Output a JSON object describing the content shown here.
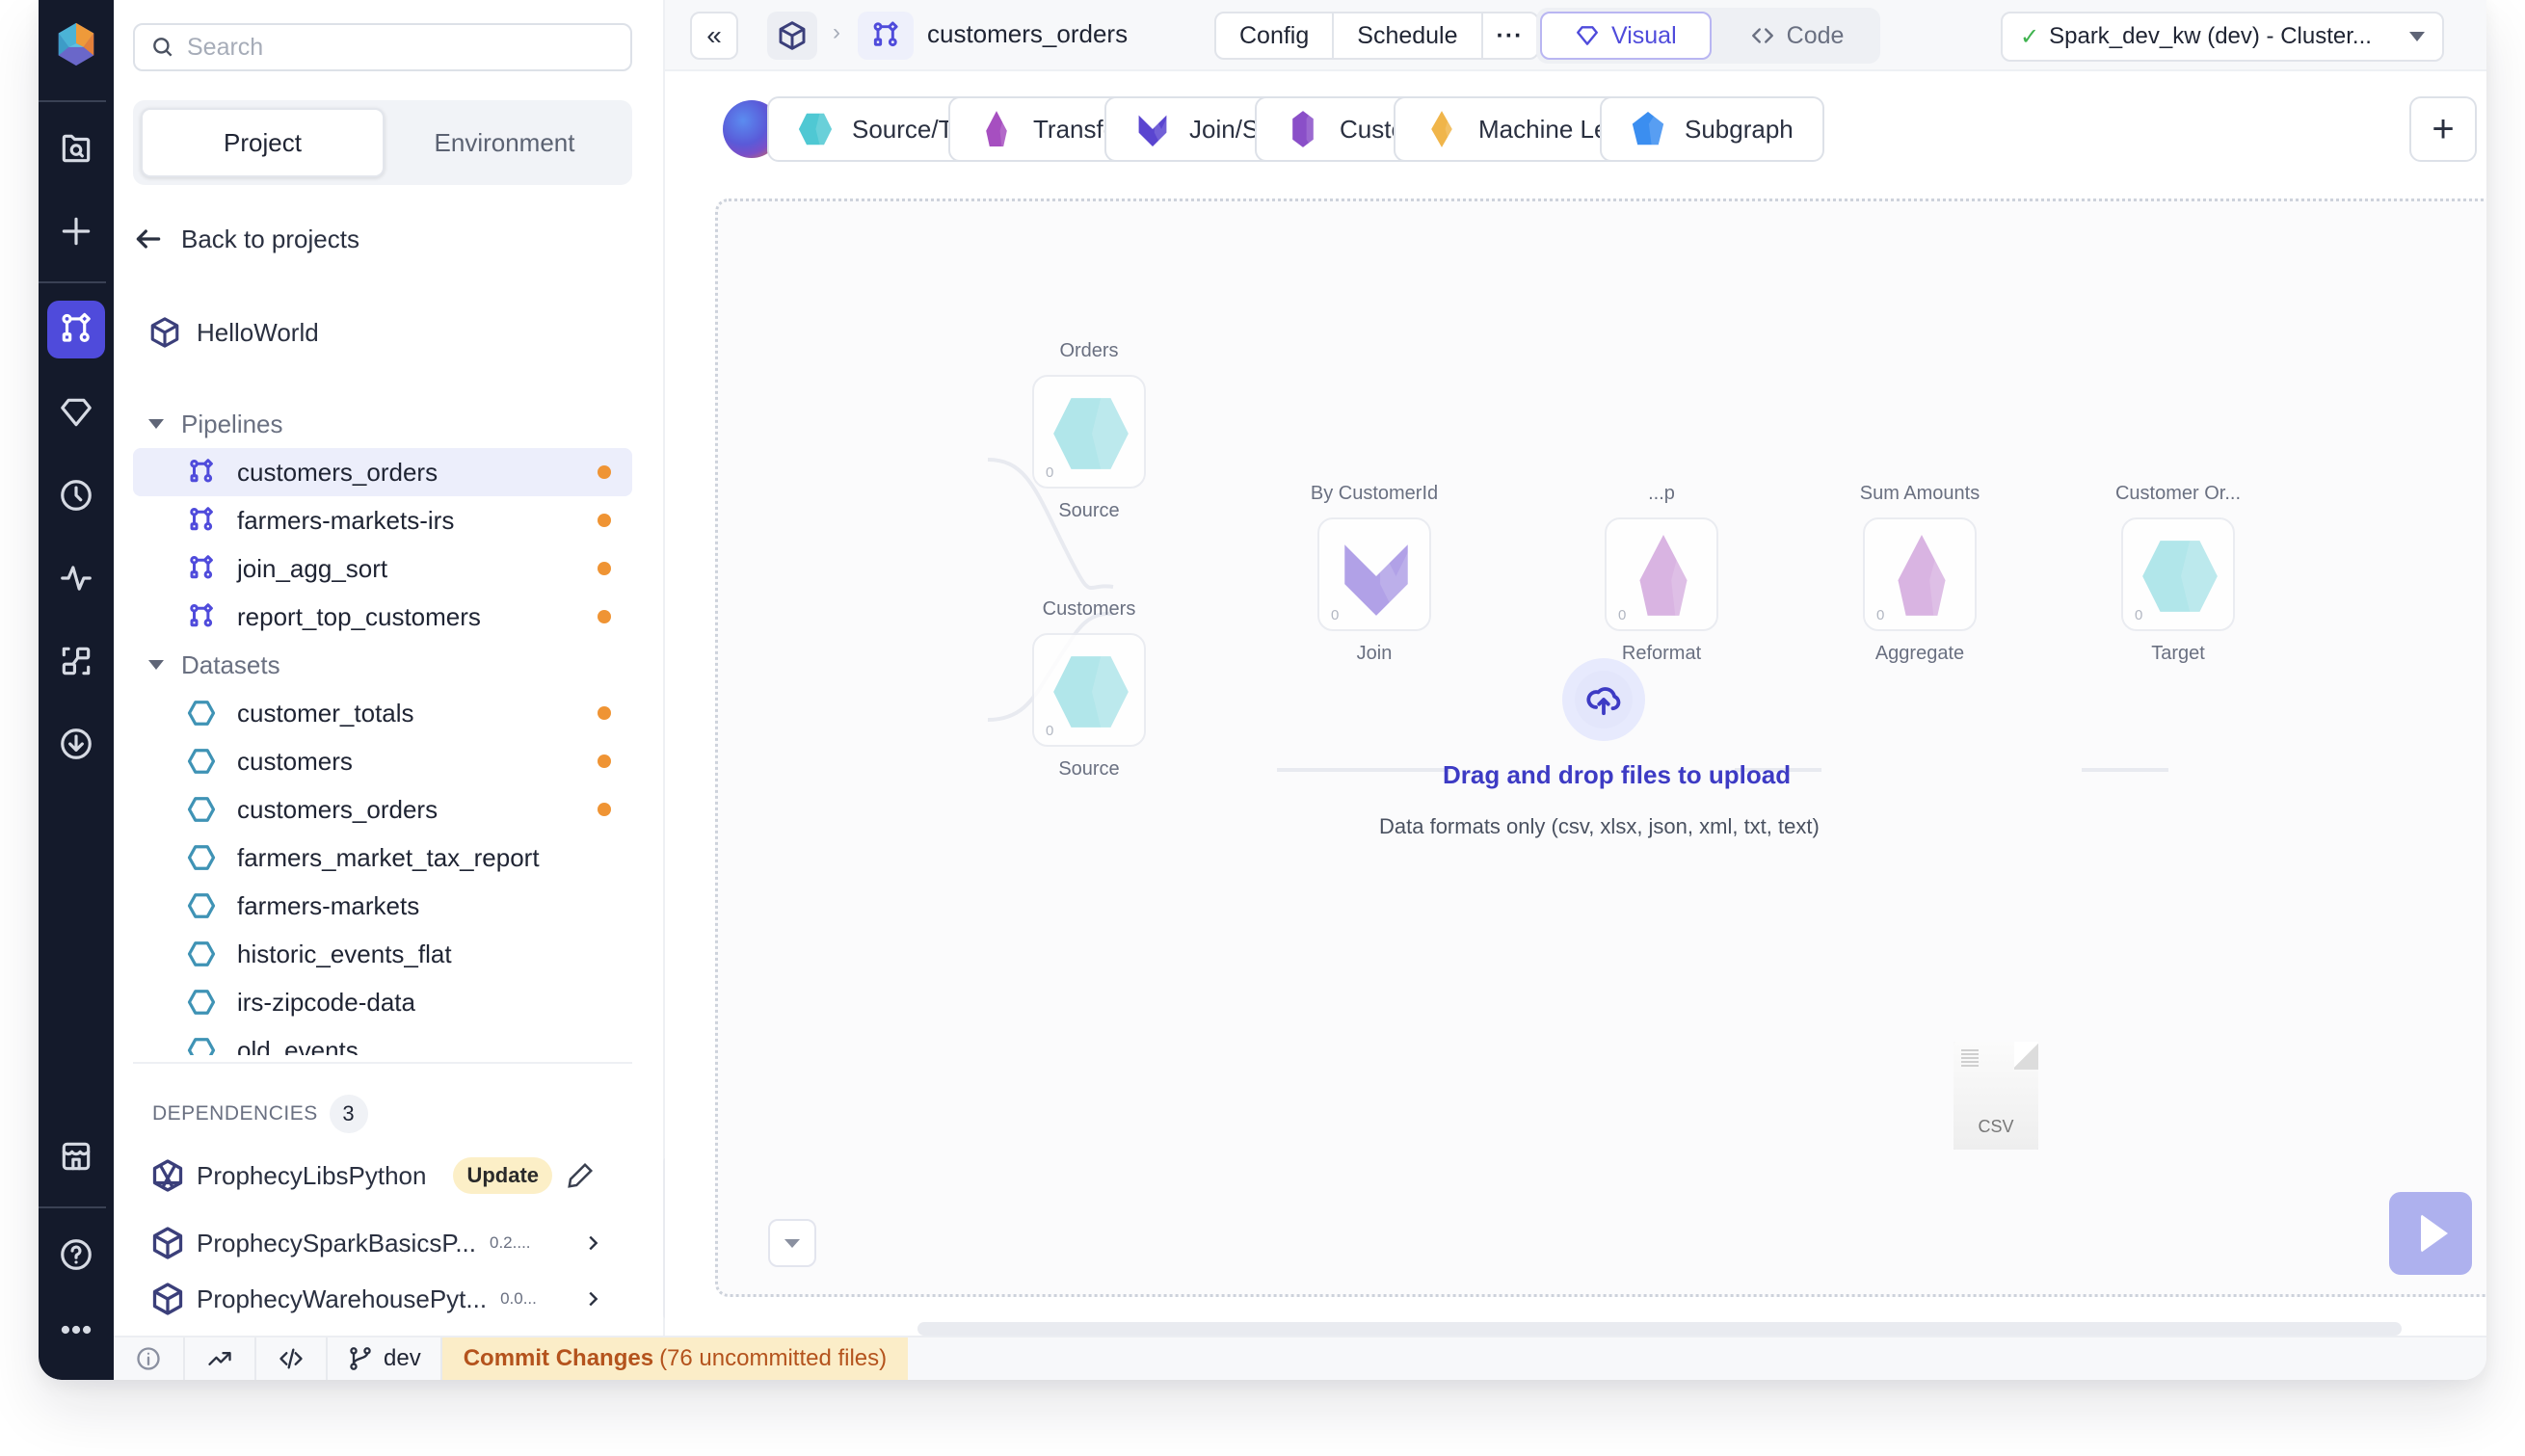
{
  "rail": {
    "items": [
      {
        "name": "logo-icon",
        "active": false
      },
      {
        "name": "browse-folder-icon",
        "active": false
      },
      {
        "name": "create-plus-icon",
        "active": false
      },
      {
        "name": "pipelines-icon",
        "active": true
      },
      {
        "name": "gems-diamond-icon",
        "active": false
      },
      {
        "name": "schedule-clock-icon",
        "active": false
      },
      {
        "name": "observability-pulse-icon",
        "active": false
      },
      {
        "name": "lineage-icon",
        "active": false
      },
      {
        "name": "download-icon",
        "active": false
      },
      {
        "name": "marketplace-store-icon",
        "active": false
      },
      {
        "name": "help-icon",
        "active": false
      },
      {
        "name": "more-icon",
        "active": false
      }
    ]
  },
  "panel": {
    "search_placeholder": "Search",
    "tabs": [
      {
        "label": "Project",
        "active": true
      },
      {
        "label": "Environment",
        "active": false
      }
    ],
    "back_label": "Back to projects",
    "project_name": "HelloWorld",
    "sections": [
      {
        "label": "Pipelines",
        "items": [
          {
            "label": "customers_orders",
            "modified": true,
            "selected": true
          },
          {
            "label": "farmers-markets-irs",
            "modified": true,
            "selected": false
          },
          {
            "label": "join_agg_sort",
            "modified": true,
            "selected": false
          },
          {
            "label": "report_top_customers",
            "modified": true,
            "selected": false
          }
        ]
      },
      {
        "label": "Datasets",
        "items": [
          {
            "label": "customer_totals",
            "modified": true
          },
          {
            "label": "customers",
            "modified": true
          },
          {
            "label": "customers_orders",
            "modified": true
          },
          {
            "label": "farmers_market_tax_report",
            "modified": false
          },
          {
            "label": "farmers-markets",
            "modified": false
          },
          {
            "label": "historic_events_flat",
            "modified": false
          },
          {
            "label": "irs-zipcode-data",
            "modified": false
          },
          {
            "label": "old_events",
            "modified": false
          }
        ]
      }
    ],
    "dependencies": {
      "label": "DEPENDENCIES",
      "count": "3",
      "items": [
        {
          "name": "ProphecyLibsPython",
          "badge": "Update"
        },
        {
          "name": "ProphecySparkBasicsP...",
          "version": "0.2...."
        },
        {
          "name": "ProphecyWarehousePyt...",
          "version": "0.0..."
        }
      ]
    }
  },
  "status_bar": {
    "branch": "dev",
    "commit_label": "Commit Changes",
    "commit_detail": "(76 uncommitted files)"
  },
  "topbar": {
    "collapse_glyph": "«",
    "pipeline_name": "customers_orders",
    "config_label": "Config",
    "schedule_label": "Schedule",
    "more_label": "···",
    "visual_label": "Visual",
    "code_label": "Code",
    "cluster_check": "✓",
    "cluster_label": "Spark_dev_kw (dev)   - Cluster..."
  },
  "palette": {
    "items": [
      {
        "label": "Source/Targ...",
        "color": "#4fc8d3",
        "shape": "hexagon"
      },
      {
        "label": "Transfor...",
        "color": "#a64fc0",
        "shape": "crystal"
      },
      {
        "label": "Join/Spl...",
        "color": "#5a45d0",
        "shape": "chevron"
      },
      {
        "label": "Custo...",
        "color": "#8a4fc8",
        "shape": "crystal-wide"
      },
      {
        "label": "Machine Learni...",
        "color": "#f0b54a",
        "shape": "diamond"
      },
      {
        "label": "Subgraph",
        "color": "#3b8ef0",
        "shape": "pentagon"
      }
    ],
    "add_label": "+"
  },
  "canvas": {
    "nodes": [
      {
        "id": "orders",
        "title": "Orders",
        "type": "Source",
        "count": "0",
        "shape": "hexagon",
        "color": "#a5e3e8"
      },
      {
        "id": "customers",
        "title": "Customers",
        "type": "Source",
        "count": "0",
        "shape": "hexagon",
        "color": "#a5e3e8"
      },
      {
        "id": "join",
        "title": "By CustomerId",
        "type": "Join",
        "count": "0",
        "shape": "chevron",
        "color": "#a592e4"
      },
      {
        "id": "reformat",
        "title": "...p",
        "type": "Reformat",
        "count": "0",
        "shape": "crystal",
        "color": "#d4a8de"
      },
      {
        "id": "aggregate",
        "title": "Sum Amounts",
        "type": "Aggregate",
        "count": "0",
        "shape": "crystal",
        "color": "#d4a8de"
      },
      {
        "id": "target",
        "title": "Customer Or...",
        "type": "Target",
        "count": "0",
        "shape": "hexagon",
        "color": "#a5e3e8"
      }
    ],
    "drop_title": "Drag and drop files to upload",
    "drop_subtitle": "Data formats only (csv, xlsx, json, xml, txt, text)",
    "dragged_file_label": "CSV"
  }
}
